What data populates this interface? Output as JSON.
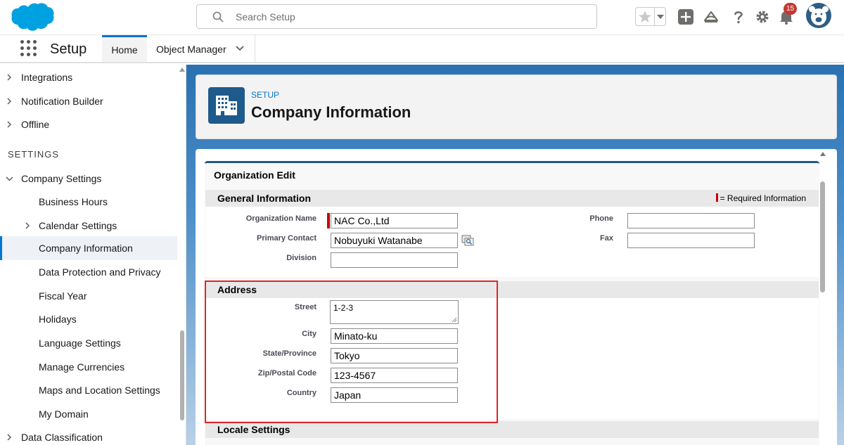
{
  "header": {
    "search_placeholder": "Search Setup",
    "notification_count": "15"
  },
  "context_bar": {
    "app_name": "Setup",
    "tabs": [
      {
        "label": "Home"
      },
      {
        "label": "Object Manager"
      }
    ]
  },
  "sidebar": {
    "items_top": [
      {
        "label": "Integrations"
      },
      {
        "label": "Notification Builder"
      },
      {
        "label": "Offline"
      }
    ],
    "section_heading": "SETTINGS",
    "company_settings": {
      "label": "Company Settings",
      "children": [
        {
          "label": "Business Hours"
        },
        {
          "label": "Calendar Settings"
        },
        {
          "label": "Company Information",
          "selected": true
        },
        {
          "label": "Data Protection and Privacy"
        },
        {
          "label": "Fiscal Year"
        },
        {
          "label": "Holidays"
        },
        {
          "label": "Language Settings"
        },
        {
          "label": "Manage Currencies"
        },
        {
          "label": "Maps and Location Settings"
        },
        {
          "label": "My Domain"
        }
      ]
    },
    "items_bottom": [
      {
        "label": "Data Classification"
      }
    ]
  },
  "page_header": {
    "eyebrow": "SETUP",
    "title": "Company Information"
  },
  "form": {
    "title": "Organization Edit",
    "general": {
      "title": "General Information",
      "required_legend": "= Required Information",
      "org_name_label": "Organization Name",
      "org_name_value": "NAC Co.,Ltd",
      "primary_contact_label": "Primary Contact",
      "primary_contact_value": "Nobuyuki Watanabe",
      "division_label": "Division",
      "division_value": "",
      "phone_label": "Phone",
      "phone_value": "",
      "fax_label": "Fax",
      "fax_value": ""
    },
    "address": {
      "title": "Address",
      "street_label": "Street",
      "street_value": "1-2-3",
      "city_label": "City",
      "city_value": "Minato-ku",
      "state_label": "State/Province",
      "state_value": "Tokyo",
      "zip_label": "Zip/Postal Code",
      "zip_value": "123-4567",
      "country_label": "Country",
      "country_value": "Japan"
    },
    "locale": {
      "title": "Locale Settings"
    }
  },
  "colors": {
    "brand": "#0176d3",
    "highlight": "#e0252a",
    "required": "#cc0000"
  }
}
